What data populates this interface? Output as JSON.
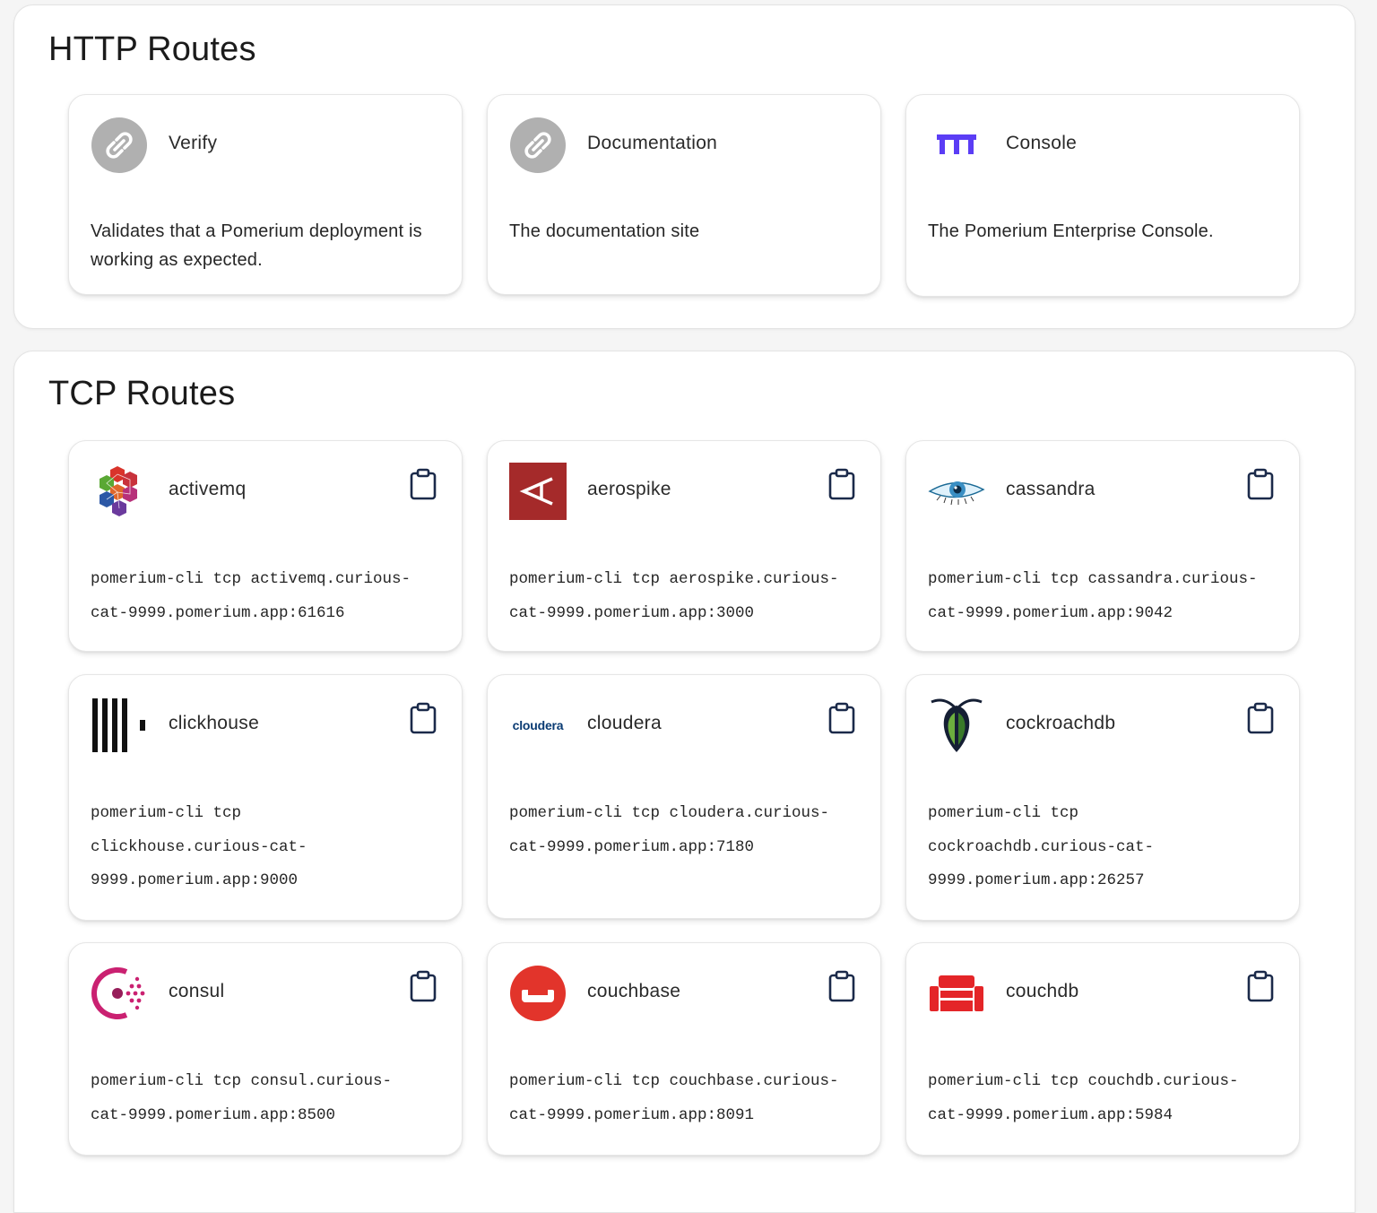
{
  "http_routes": {
    "title": "HTTP Routes",
    "cards": [
      {
        "title": "Verify",
        "description": "Validates that a Pomerium deployment is working as expected.",
        "icon": "link-icon"
      },
      {
        "title": "Documentation",
        "description": "The documentation site",
        "icon": "link-icon"
      },
      {
        "title": "Console",
        "description": "The Pomerium Enterprise Console.",
        "icon": "pomerium-logo-icon"
      }
    ]
  },
  "tcp_routes": {
    "title": "TCP Routes",
    "cards": [
      {
        "title": "activemq",
        "command": "pomerium-cli tcp activemq.curious-cat-9999.pomerium.app:61616",
        "icon": "activemq-logo"
      },
      {
        "title": "aerospike",
        "command": "pomerium-cli tcp aerospike.curious-cat-9999.pomerium.app:3000",
        "icon": "aerospike-logo"
      },
      {
        "title": "cassandra",
        "command": "pomerium-cli tcp cassandra.curious-cat-9999.pomerium.app:9042",
        "icon": "cassandra-logo"
      },
      {
        "title": "clickhouse",
        "command": "pomerium-cli tcp clickhouse.curious-cat-9999.pomerium.app:9000",
        "icon": "clickhouse-logo"
      },
      {
        "title": "cloudera",
        "command": "pomerium-cli tcp cloudera.curious-cat-9999.pomerium.app:7180",
        "icon": "cloudera-logo",
        "logo_text": "cloudera"
      },
      {
        "title": "cockroachdb",
        "command": "pomerium-cli tcp cockroachdb.curious-cat-9999.pomerium.app:26257",
        "icon": "cockroachdb-logo"
      },
      {
        "title": "consul",
        "command": "pomerium-cli tcp consul.curious-cat-9999.pomerium.app:8500",
        "icon": "consul-logo"
      },
      {
        "title": "couchbase",
        "command": "pomerium-cli tcp couchbase.curious-cat-9999.pomerium.app:8091",
        "icon": "couchbase-logo"
      },
      {
        "title": "couchdb",
        "command": "pomerium-cli tcp couchdb.curious-cat-9999.pomerium.app:5984",
        "icon": "couchdb-logo"
      }
    ],
    "copy_icon": "clipboard-icon"
  },
  "colors": {
    "link_icon_bg": "#b0b0b0",
    "pomerium_purple": "#5b3df5",
    "aerospike_red": "#a52a2a",
    "couchbase_red": "#e2342b",
    "couchdb_red": "#e42528",
    "consul_pink": "#ca2171",
    "cloudera_blue": "#0a3b73",
    "icon_dark": "#1a1a2e"
  }
}
